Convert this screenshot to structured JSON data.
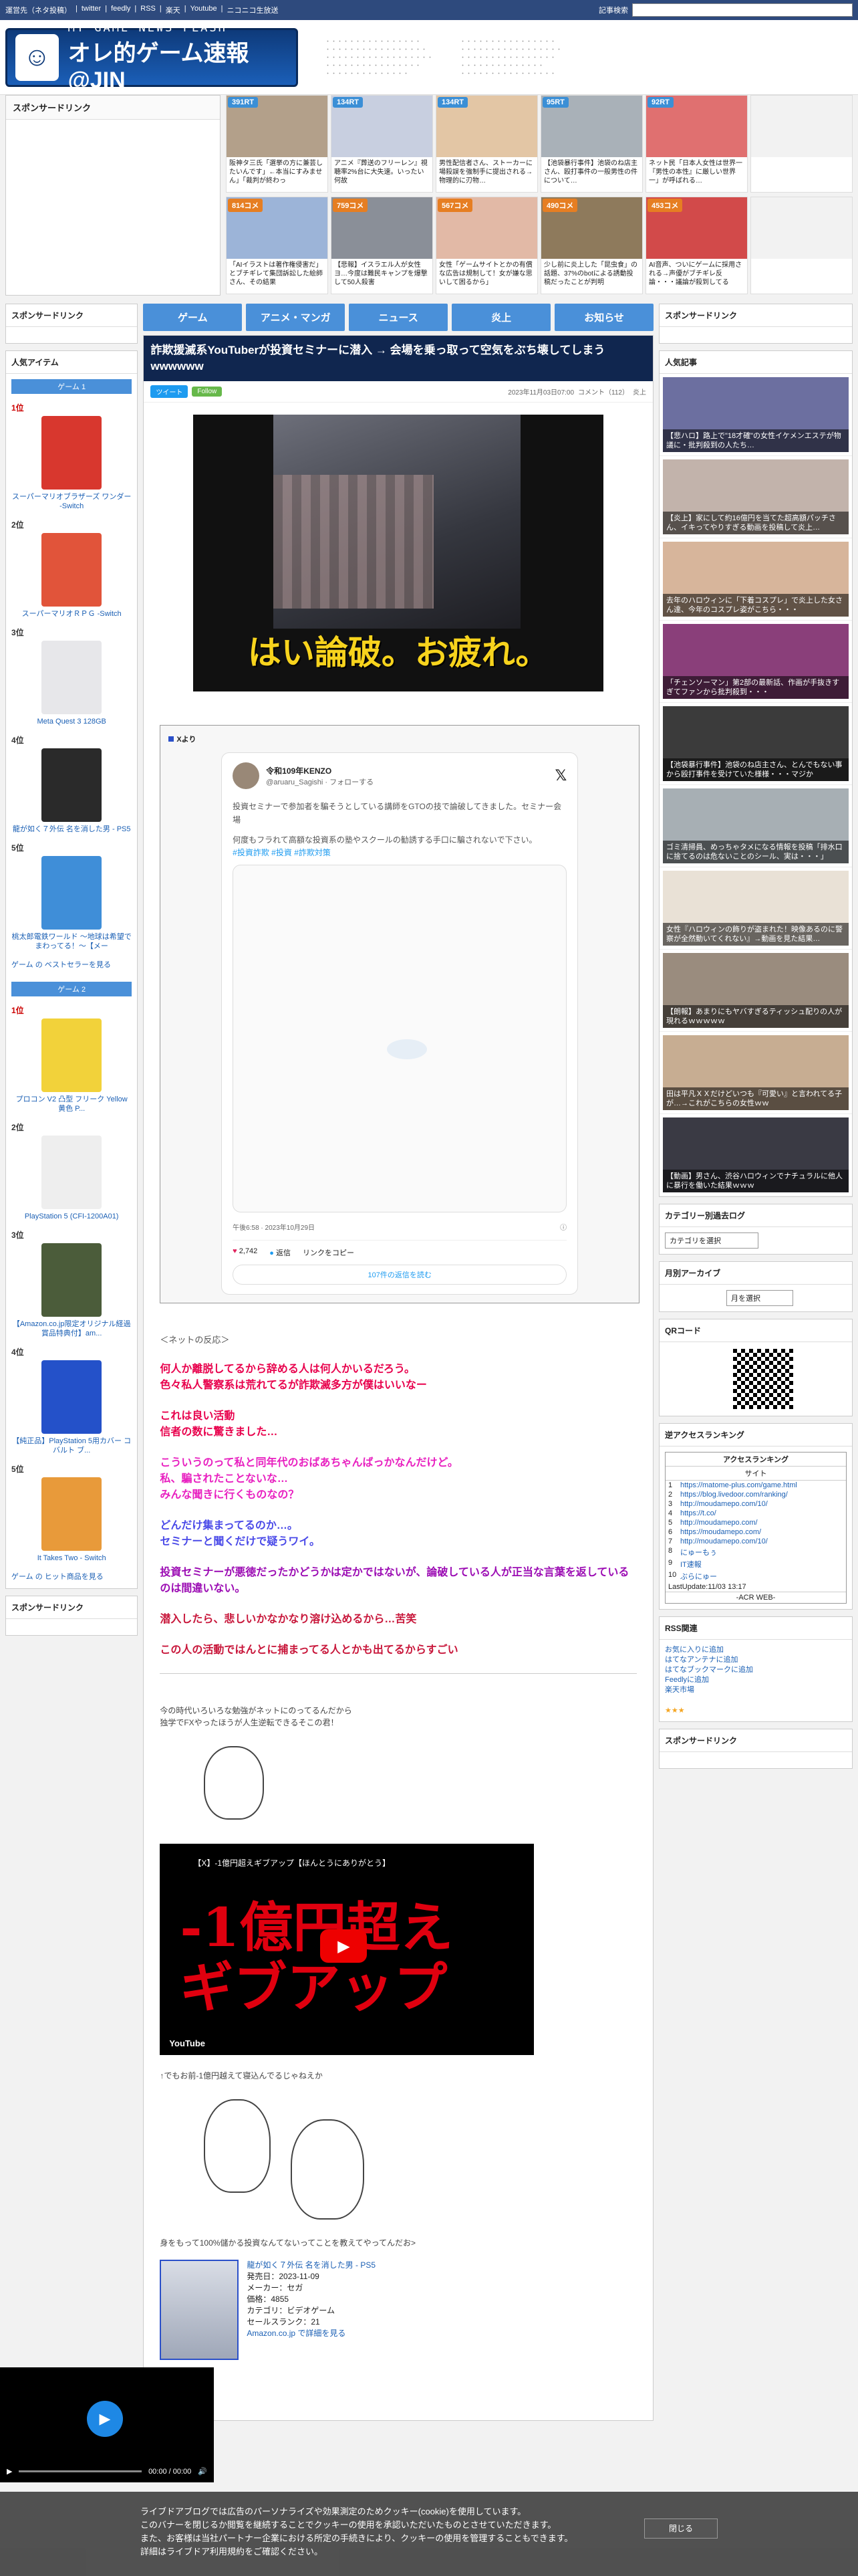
{
  "topnav": {
    "links": [
      "運営先（ネタ投稿）",
      "twitter",
      "feedly",
      "RSS",
      "楽天",
      "Youtube",
      "ニコニコ生放送"
    ],
    "search_label": "記事検索"
  },
  "logo": {
    "sub": "MY GAME NEWS FLASH",
    "main": "オレ的ゲーム速報@JIN"
  },
  "ads_title": "スポンサードリンク",
  "thumbs": [
    {
      "badge": "391RT",
      "type": "rt",
      "caption": "阪神タ三氏「選挙の方に兼芸したいんです」←本当にすみません」「裁判が終わっ",
      "color": "#b3a08a"
    },
    {
      "badge": "134RT",
      "type": "rt",
      "caption": "アニメ『葬送のフリーレン』視聴率2%台に大失速。いったい何故",
      "color": "#c8cfe0"
    },
    {
      "badge": "134RT",
      "type": "rt",
      "caption": "男性配信者さん、ストーカーに場殺誤を強制手に提出される→物理的に刃物…",
      "color": "#e3c6a5"
    },
    {
      "badge": "95RT",
      "type": "rt",
      "caption": "【池袋暴行事件】池袋のね店主さん、殴打事件の一般男性の件について…",
      "color": "#a9b1b8"
    },
    {
      "badge": "92RT",
      "type": "rt",
      "caption": "ネット民「日本人女性は世界一『男性の本性』に厳しい世界一」が呼ばれる…",
      "color": "#e07070"
    },
    {
      "badge": "",
      "type": "rt",
      "caption": "",
      "color": "#f2f2f2"
    },
    {
      "badge": "814コメ",
      "type": "cm",
      "caption": "「AIイラストは著作権侵害だ」とブチギレて集団訴訟した絵師さん、その結果",
      "color": "#9cb4d8"
    },
    {
      "badge": "759コメ",
      "type": "cm",
      "caption": "【悲報】イスラエル人が女性ヨ…今度は難民キャンプを爆撃して50人殺害",
      "color": "#8a8f98"
    },
    {
      "badge": "567コメ",
      "type": "cm",
      "caption": "女性「ゲームサイトとかの有償な広告は規制して！女が嫌な思いして困るから」",
      "color": "#e2b9a6"
    },
    {
      "badge": "490コメ",
      "type": "cm",
      "caption": "少し前に炎上した「昆虫食」の話題、37%のbotによる誘動投稿だったことが判明",
      "color": "#8e7a5c"
    },
    {
      "badge": "453コメ",
      "type": "cm",
      "caption": "AI音声、ついにゲームに採用される→声優がブチギレ反論・・・議論が殺到してる",
      "color": "#d24a4a"
    },
    {
      "badge": "",
      "type": "cm",
      "caption": "",
      "color": "#f2f2f2"
    }
  ],
  "left": {
    "sponsor_title": "スポンサードリンク",
    "popular_title": "人気アイテム",
    "game1_head": "ゲーム 1",
    "game1_items": [
      {
        "rank": "1位",
        "name": "スーパーマリオブラザーズ ワンダー -Switch",
        "color": "#d8372e"
      },
      {
        "rank": "2位",
        "name": "スーパーマリオＲＰＧ -Switch",
        "color": "#e1543a"
      },
      {
        "rank": "3位",
        "name": "Meta Quest 3 128GB",
        "color": "#e7e7ea"
      },
      {
        "rank": "4位",
        "name": "龍が如く７外伝 名を消した男 - PS5",
        "color": "#2a2a2a"
      },
      {
        "rank": "5位",
        "name": "桃太郎電鉄ワールド ～地球は希望でまわってる！～【メー",
        "color": "#3f8ed8"
      }
    ],
    "game1_more": "ゲーム の ベストセラーを見る",
    "game2_head": "ゲーム 2",
    "game2_items": [
      {
        "rank": "1位",
        "name": "プロコン V2 凸型 フリーク Yellow 黄色 P...",
        "color": "#f2d23a"
      },
      {
        "rank": "2位",
        "name": "PlayStation 5 (CFI-1200A01)",
        "color": "#eeeeee"
      },
      {
        "rank": "3位",
        "name": "【Amazon.co.jp限定オリジナル経過賞品特典付】am...",
        "color": "#4b5c3a"
      },
      {
        "rank": "4位",
        "name": "【純正品】PlayStation 5用カバー コバルト ブ...",
        "color": "#2451c9"
      },
      {
        "rank": "5位",
        "name": "It Takes Two - Switch",
        "color": "#e89a3a"
      }
    ],
    "game2_more": "ゲーム の ヒット商品を見る",
    "sponsor_title2": "スポンサードリンク"
  },
  "tabs": [
    "ゲーム",
    "アニメ・マンガ",
    "ニュース",
    "炎上",
    "お知らせ"
  ],
  "article": {
    "title": "詐欺援滅系YouTuberが投資セミナーに潜入 → 会場を乗っ取って空気をぶち壊してしまうwwwwww",
    "tweet_btn": "ツイート",
    "follow_btn": "Follow",
    "date": "2023年11月03日07:00",
    "comment": "コメント（112）",
    "category": "炎上",
    "hero_caption": "はい論破。お疲れ。",
    "embed_label": "Xより",
    "tweet": {
      "name": "令和109年KENZO",
      "handle": "@aruaru_Sagishi · フォローする",
      "text1": "投資セミナーで参加者を騙そうとしている講師をGTOの技で論破してきました。セミナー会場",
      "text2": "何度もフラれて高額な投資系の塾やスクールの勧誘する手口に騙されないで下さい。",
      "tags": "#投資詐欺 #投資 #詐欺対策",
      "time": "午後6:58 · 2023年10月29日",
      "likes": "2,742",
      "reply": "返信",
      "copy": "リンクをコピー",
      "more": "107件の返信を読む"
    },
    "net_label": "＜ネットの反応＞",
    "reactions": [
      {
        "cls": "c-red",
        "text": "何人か離脱してるから辞める人は何人かいるだろう。\n色々私人警察系は荒れてるが詐欺滅多方が僕はいいなー"
      },
      {
        "cls": "c-red",
        "text": "これは良い活動\n信者の数に驚きました…"
      },
      {
        "cls": "c-pink",
        "text": "こういうのって私と同年代のおばあちゃんばっかなんだけど。\n私、騙されたことないな…\nみんな聞きに行くものなの？"
      },
      {
        "cls": "c-blue",
        "text": "どんだけ集まってるのか…。\nセミナーと聞くだけで疑うワイ。"
      },
      {
        "cls": "c-purple",
        "text": "投資セミナーが悪徳だったかどうかは定かではないが、論破している人が正当な言葉を返しているのは間違いない。"
      },
      {
        "cls": "c-crimson",
        "text": "潜入したら、悲しいかなかなり溶け込めるから…苦笑"
      },
      {
        "cls": "c-crimson",
        "text": "この人の活動ではんとに捕まってる人とかも出てるからすごい"
      }
    ],
    "para1": "今の時代いろいろな勉強がネットにのってるんだから\n独学でFXやったほうが人生逆転できるそこの君！",
    "video_title": "【X】-1億円超えギブアップ【ほんとうにありがとう】",
    "video_big": "-1億円超え\nギブアップ",
    "video_yt": "YouTube",
    "para2": "↑でもお前-1億円越えて寝込んでるじゃねえか",
    "para3": "身をもって100%儲かる投資なんてないってことを教えてやってんだお>",
    "product": {
      "name": "龍が如く７外伝 名を消した男 - PS5",
      "release": "発売日：2023-11-09",
      "maker": "メーカー：セガ",
      "price": "価格：4855",
      "category": "カテゴリ：ビデオゲーム",
      "rank": "セールスランク：21",
      "link": "Amazon.co.jp で詳細を見る"
    }
  },
  "right": {
    "sponsor_title": "スポンサードリンク",
    "popular_title": "人気記事",
    "popular": [
      {
        "text": "【悲ハロ】路上で\"18才確\"の女性イケメンエステが物議に・批判殺到の人たち…",
        "color": "#6c6fa0"
      },
      {
        "text": "【炎上】家にして約16億円を当てた超高額パッチさん、イキってやりすぎる動画を投稿して炎上…",
        "color": "#c2b3ab"
      },
      {
        "text": "去年のハロウィンに「下着コスプレ」で炎上した女さん達、今年のコスプレ姿がこちら・・・",
        "color": "#d7b59b"
      },
      {
        "text": "「チェンソーマン」第2部の最新話、作画が手抜きすぎてファンから批判殺到・・・",
        "color": "#8a3f7a"
      },
      {
        "text": "【池袋暴行事件】池袋のね店主さん、とんでもない事から殴打事件を受けていた様様・・・マジか",
        "color": "#3b3b3b"
      },
      {
        "text": "ゴミ清掃員、めっちゃタメになる情報を投稿「排水口に捨てるのは危ないことのシール、実は・・・」",
        "color": "#a7afb4"
      },
      {
        "text": "女性『ハロウィンの飾りが盗まれた！映像あるのに警察が全然動いてくれない』→動画を見た結果…",
        "color": "#e9e1d6"
      },
      {
        "text": "【朗報】あまりにもヤバすぎるティッシュ配りの人が現れるｗｗｗｗｗ",
        "color": "#9a8c7e"
      },
      {
        "text": "田は平凡ＸＸだけどいつも『可愛い』と言われてる子が…→これがこちらの女性ｗｗ",
        "color": "#c7ad92"
      },
      {
        "text": "【動画】男さん、渋谷ハロウィンでナチュラルに他人に暴行を働いた結果ｗｗｗ",
        "color": "#3a3a44"
      }
    ],
    "cat_title": "カテゴリー別過去ログ",
    "cat_select": "カテゴリを選択",
    "month_title": "月別アーカイブ",
    "month_select": "月を選択",
    "qr_title": "QRコード",
    "acr_title": "逆アクセスランキング",
    "acr_head": "アクセスランキング",
    "acr_sub": "サイト",
    "acr_rows": [
      "https://matome-plus.com/game.html",
      "https://blog.livedoor.com/ranking/",
      "http://moudamepo.com/10/",
      "https://t.co/",
      "http://moudamepo.com/",
      "https://moudamepo.com/",
      "http://moudamepo.com/10/",
      "にゅーもぅ",
      "IT速報",
      "ぶらにゅー"
    ],
    "acr_update": "LastUpdate:11/03 13:17",
    "acr_foot": "-ACR WEB-",
    "rss_title": "RSS関連",
    "rss_links": [
      "お気に入りに追加",
      "はてなアンテナに追加",
      "はてなブックマークに追加",
      "Feedlyに追加",
      "楽天市場"
    ],
    "sponsor_title2": "スポンサードリンク"
  },
  "audio": {
    "time": "00:00 / 00:00"
  },
  "cookie": {
    "text1": "ライブドアブログでは広告のパーソナライズや効果測定のためクッキー(cookie)を使用しています。",
    "text2": "このバナーを閉じるか閲覧を継続することでクッキーの使用を承認いただいたものとさせていただきます。",
    "text3": "また、お客様は当社パートナー企業における所定の手続きにより、クッキーの使用を管理することもできます。",
    "text4": "詳細はライブドア利用規約をご確認ください。",
    "close": "閉じる"
  }
}
